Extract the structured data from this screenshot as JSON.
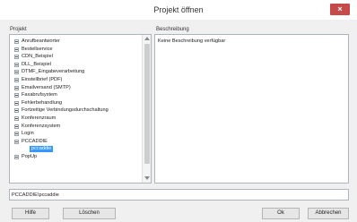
{
  "window": {
    "title": "Projekt öffnen",
    "close_label": "×"
  },
  "left_panel": {
    "label": "Projekt",
    "items": [
      {
        "label": "Anrufbeantworter"
      },
      {
        "label": "Bestellservice"
      },
      {
        "label": "CDN_Beispiel"
      },
      {
        "label": "DLL_Beispiel"
      },
      {
        "label": "DTMF_Eingabeverarbeitung"
      },
      {
        "label": "Einstellbrief (PDF)"
      },
      {
        "label": "Emailversand (SMTP)"
      },
      {
        "label": "Faxabrufsystem"
      },
      {
        "label": "Fehlerbehandlung"
      },
      {
        "label": "Fortzeitige Verbindungsdurchschaltung"
      },
      {
        "label": "Konferenzraum"
      },
      {
        "label": "Konferenzsystem"
      },
      {
        "label": "Login"
      },
      {
        "label": "PCCADDIE"
      }
    ],
    "child_item": "pccaddie",
    "after_items": [
      {
        "label": "PopUp"
      }
    ]
  },
  "right_panel": {
    "label": "Beschreibung",
    "text": "Keine Beschreibung verfügbar"
  },
  "path_field": {
    "value": "PCCADDIE\\pccaddie"
  },
  "buttons": {
    "help": "Hilfe",
    "delete": "Löschen",
    "ok": "Ok",
    "cancel": "Abbrechen"
  },
  "colors": {
    "selection": "#3399ff",
    "close_button": "#c74a4a",
    "marker_arrow": "#e01010"
  }
}
